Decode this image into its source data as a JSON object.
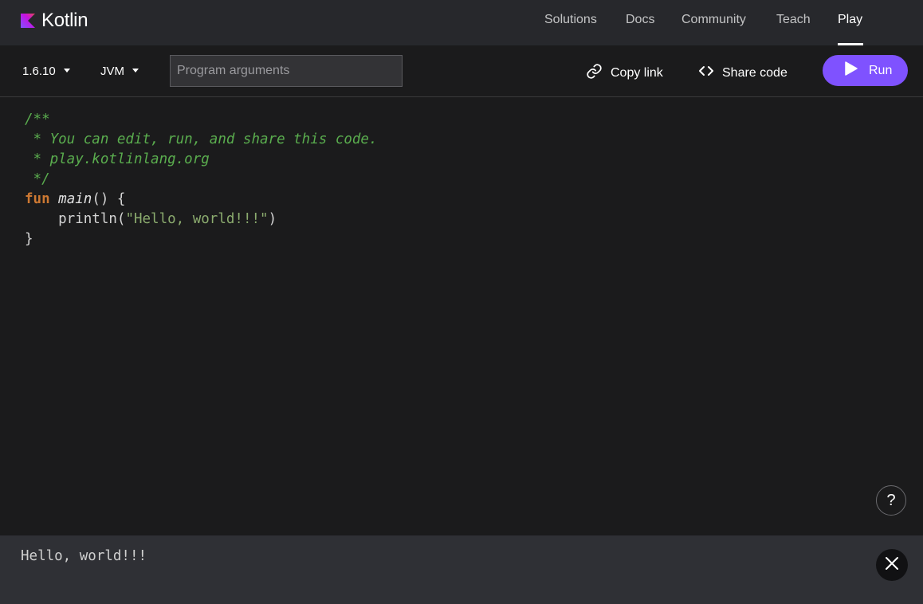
{
  "nav": {
    "logo_text": "Kotlin",
    "items": [
      {
        "label": "Solutions"
      },
      {
        "label": "Docs"
      },
      {
        "label": "Community"
      },
      {
        "label": "Teach"
      },
      {
        "label": "Play"
      }
    ],
    "active_item": "Play"
  },
  "toolbar": {
    "version": "1.6.10",
    "target": "JVM",
    "args_placeholder": "Program arguments",
    "args_value": "",
    "copy_link_label": "Copy link",
    "share_code_label": "Share code",
    "run_label": "Run"
  },
  "editor": {
    "lines": [
      "/**",
      " * You can edit, run, and share this code.",
      " * play.kotlinlang.org",
      " */",
      "fun",
      " ",
      "main",
      "() {",
      "    println(",
      "\"Hello, world!!!\"",
      ")",
      "}"
    ],
    "help_label": "?"
  },
  "output": {
    "text": "Hello, world!!!"
  },
  "icons": {
    "logo": "kotlin-logo-icon",
    "version_caret": "caret-down-icon",
    "target_caret": "caret-down-icon",
    "copy_link": "link-icon",
    "share_code": "code-brackets-icon",
    "run": "play-icon",
    "close": "close-icon"
  },
  "colors": {
    "accent": "#7f52ff",
    "nav_bg": "#27282c",
    "editor_bg": "#1b1b1c",
    "output_bg": "#2f3035",
    "comment": "#5aad4e",
    "keyword": "#cc7832",
    "string": "#8bab6e"
  }
}
